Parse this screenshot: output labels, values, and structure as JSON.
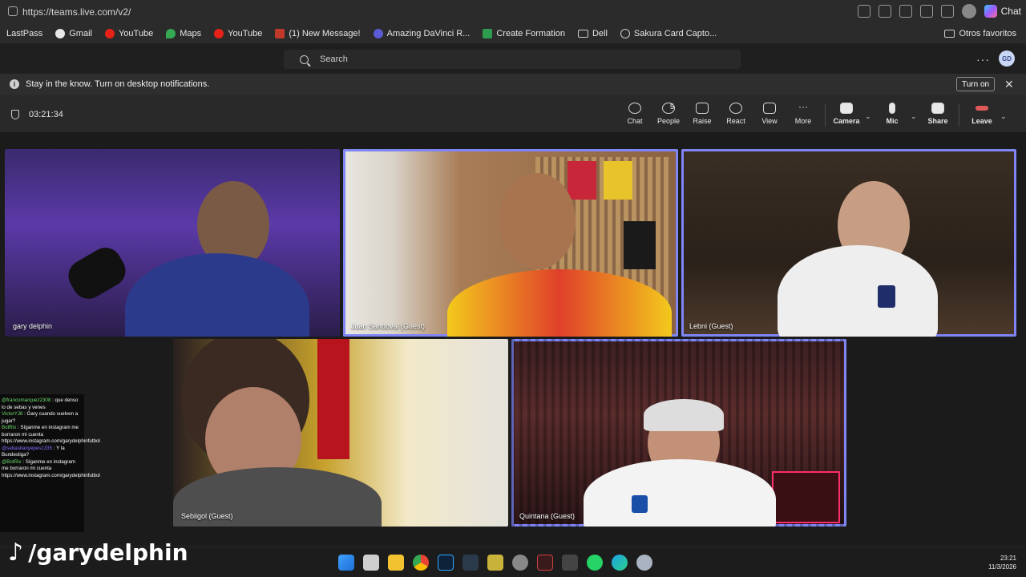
{
  "browser": {
    "url": "https://teams.live.com/v2/",
    "chat_label": "Chat",
    "bookmarks": [
      "LastPass",
      "Gmail",
      "YouTube",
      "Maps",
      "YouTube",
      "(1) New Message!",
      "Amazing DaVinci R...",
      "Create Formation",
      "Dell",
      "Sakura Card Capto..."
    ],
    "other_favorites": "Otros favoritos"
  },
  "teams": {
    "search_placeholder": "Search",
    "user_initials": "GD",
    "notification": {
      "text": "Stay in the know. Turn on desktop notifications.",
      "button": "Turn on"
    },
    "meeting": {
      "timer": "03:21:34",
      "people_count": "5",
      "controls": [
        "Chat",
        "People",
        "Raise",
        "React",
        "View",
        "More",
        "Camera",
        "Mic",
        "Share",
        "Leave"
      ]
    },
    "participants": [
      {
        "name": "gary delphin"
      },
      {
        "name": "Juan Sandoval (Guest)"
      },
      {
        "name": "Lebni (Guest)"
      },
      {
        "name": "Sebiigol (Guest)"
      },
      {
        "name": "Quintana (Guest)"
      }
    ]
  },
  "stream_chat": {
    "lines": [
      {
        "user": "@francomarquez2308",
        "text": ": que denso lo de sebas y venes"
      },
      {
        "user": "VictorYJ8",
        "text": ": Gary cuando vuelven a jugar?"
      },
      {
        "user": "BotRix",
        "text": ": Síganme en instagram me borraron mi cuenta https://www.instagram.com/garydelphinfutbol"
      },
      {
        "user": "@sebastianyepes1335",
        "text": ": Y la Bundesliga?"
      },
      {
        "user": "@BotRix",
        "text": ": Síganme en instagram me borraron mi cuenta https://www.instagram.com/garydelphinfutbol"
      }
    ]
  },
  "overlay": {
    "tiktok_handle": "/garydelphin"
  },
  "taskbar": {
    "time": "23:21",
    "date": "11/3/2026"
  }
}
